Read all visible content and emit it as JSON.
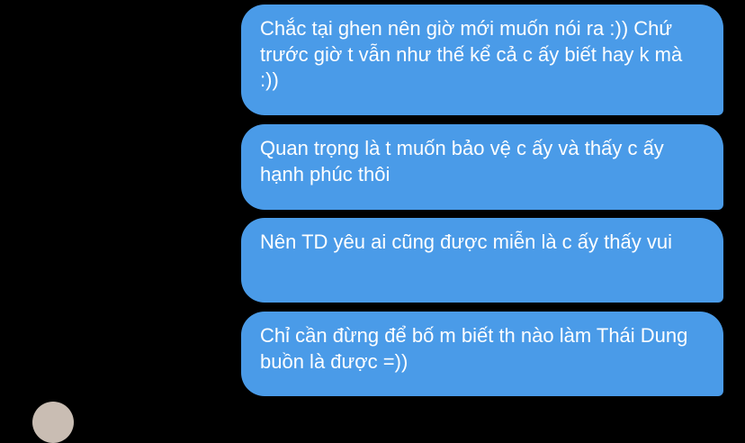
{
  "messages": [
    {
      "text": "Chắc tại ghen nên giờ mới muốn nói ra :)) Chứ trước giờ t vẫn như thế kể cả c ấy biết hay k mà :))"
    },
    {
      "text": "Quan trọng là t muốn bảo vệ c ấy và thấy c ấy hạnh phúc thôi"
    },
    {
      "text": "Nên TD yêu ai cũng được miễn là c ấy thấy vui"
    },
    {
      "text": "Chỉ cần đừng để bố m biết th nào làm Thái Dung buồn là được =))"
    }
  ],
  "colors": {
    "background": "#000000",
    "bubble": "#4a9be8",
    "bubble_text": "#ffffff"
  }
}
